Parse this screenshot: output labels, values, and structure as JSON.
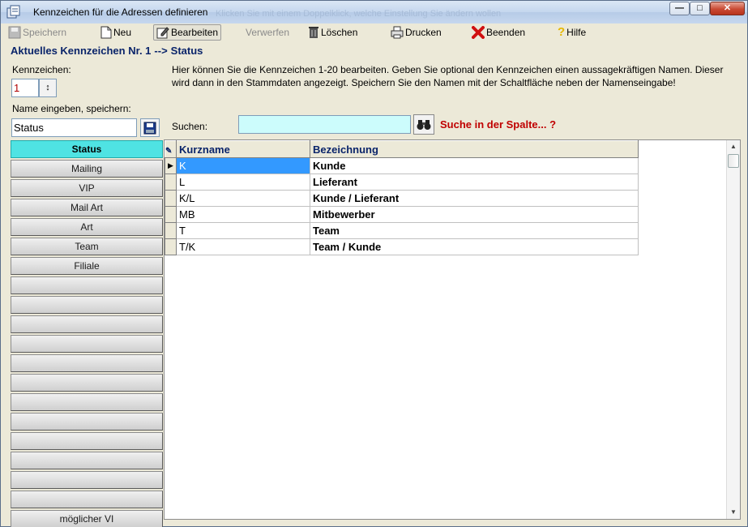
{
  "window": {
    "title": "Kennzeichen für die Adressen definieren",
    "background_ghost": "Klicken Sie mit einem Doppelklick, welche Einstellung Sie ändern wollen"
  },
  "toolbar": {
    "save": "Speichern",
    "new": "Neu",
    "edit": "Bearbeiten",
    "discard": "Verwerfen",
    "delete": "Löschen",
    "print": "Drucken",
    "exit": "Beenden",
    "help": "Hilfe"
  },
  "header": {
    "prefix": "Aktuelles Kennzeichen Nr. 1",
    "arrow": "-->",
    "current": "Status"
  },
  "left": {
    "kennzeichen_label": "Kennzeichen:",
    "kennzeichen_value": "1",
    "name_label": "Name eingeben, speichern:",
    "name_value": "Status"
  },
  "info_text": "Hier können Sie die Kennzeichen 1-20 bearbeiten. Geben Sie optional den Kennzeichen einen aussagekräftigen Namen. Dieser wird dann in den Stammdaten angezeigt. Speichern Sie den Namen mit der Schaltfläche neben der Namenseingabe!",
  "search": {
    "label": "Suchen:",
    "value": "",
    "hint": "Suche in der Spalte... ?"
  },
  "categories": [
    "Status",
    "Mailing",
    "VIP",
    "Mail Art",
    "Art",
    "Team",
    "Filiale",
    "",
    "",
    "",
    "",
    "",
    "",
    "",
    "",
    "",
    "",
    "",
    "",
    "möglicher VI"
  ],
  "grid": {
    "columns": [
      "Kurzname",
      "Bezeichnung"
    ],
    "rows": [
      [
        "K",
        "Kunde"
      ],
      [
        "L",
        "Lieferant"
      ],
      [
        "K/L",
        "Kunde / Lieferant"
      ],
      [
        "MB",
        "Mitbewerber"
      ],
      [
        "T",
        "Team"
      ],
      [
        "T/K",
        "Team / Kunde"
      ]
    ]
  },
  "colors": {
    "header_text": "#0a246a",
    "search_hint": "#c00000",
    "selected_category": "#4fe3e3",
    "selected_cell": "#3399ff",
    "search_field_bg": "#ccfcfc"
  }
}
